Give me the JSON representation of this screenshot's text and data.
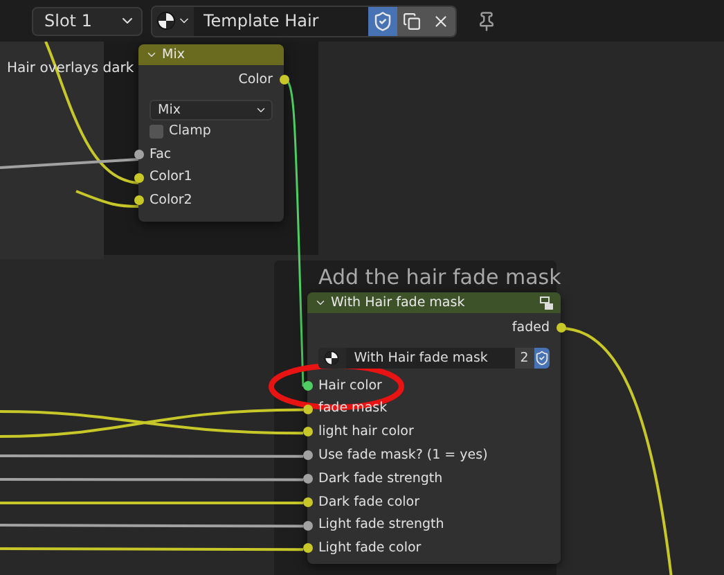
{
  "header": {
    "slot": "Slot 1",
    "material": "Template Hair",
    "fake_user": true
  },
  "frames": [
    {
      "label": "Hair overlays dark"
    },
    {
      "label": "Add the hair fade mask"
    }
  ],
  "mix_node": {
    "title": "Mix",
    "output": "Color",
    "blend": "Mix",
    "clamp": {
      "label": "Clamp",
      "checked": false
    },
    "inputs": [
      {
        "label": "Fac",
        "kind": "float"
      },
      {
        "label": "Color1",
        "kind": "color"
      },
      {
        "label": "Color2",
        "kind": "color"
      }
    ]
  },
  "group_node": {
    "title": "With Hair fade mask",
    "output": "faded",
    "datablock": "With Hair fade mask",
    "users": "2",
    "fake_user": true,
    "inputs": [
      {
        "label": "Hair color",
        "kind": "shader"
      },
      {
        "label": "fade mask",
        "kind": "color"
      },
      {
        "label": "light hair color",
        "kind": "color"
      },
      {
        "label": "Use fade mask? (1 = yes)",
        "kind": "float"
      },
      {
        "label": "Dark fade strength",
        "kind": "float"
      },
      {
        "label": "Dark fade color",
        "kind": "color"
      },
      {
        "label": "Light fade strength",
        "kind": "float"
      },
      {
        "label": "Light fade color",
        "kind": "color"
      }
    ]
  }
}
